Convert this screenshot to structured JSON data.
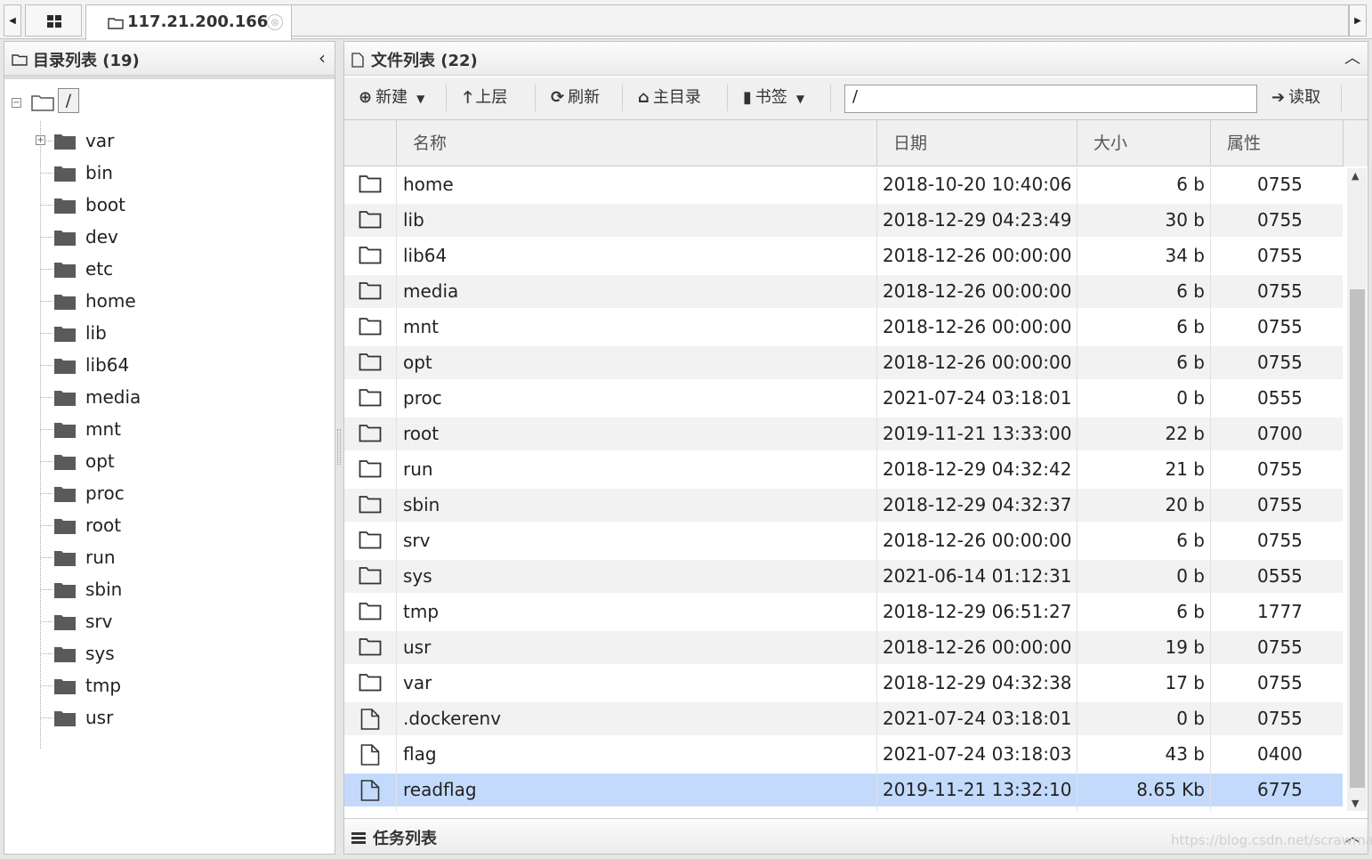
{
  "tabs": {
    "active_label": "117.21.200.166",
    "close_symbol": "⊗"
  },
  "left_panel": {
    "title": "目录列表 (19)",
    "root_label": "/",
    "tree": [
      {
        "label": "var",
        "expandable": true
      },
      {
        "label": "bin"
      },
      {
        "label": "boot"
      },
      {
        "label": "dev"
      },
      {
        "label": "etc"
      },
      {
        "label": "home"
      },
      {
        "label": "lib"
      },
      {
        "label": "lib64"
      },
      {
        "label": "media"
      },
      {
        "label": "mnt"
      },
      {
        "label": "opt"
      },
      {
        "label": "proc"
      },
      {
        "label": "root"
      },
      {
        "label": "run"
      },
      {
        "label": "sbin"
      },
      {
        "label": "srv"
      },
      {
        "label": "sys"
      },
      {
        "label": "tmp"
      },
      {
        "label": "usr"
      }
    ]
  },
  "right_panel": {
    "title": "文件列表 (22)",
    "toolbar": {
      "new_label": "新建",
      "up_label": "上层",
      "refresh_label": "刷新",
      "home_label": "主目录",
      "bookmark_label": "书签",
      "path_value": "/",
      "read_label": "读取"
    },
    "columns": {
      "name": "名称",
      "date": "日期",
      "size": "大小",
      "perm": "属性"
    },
    "files": [
      {
        "type": "folder",
        "name": "home",
        "date": "2018-10-20 10:40:06",
        "size": "6 b",
        "perm": "0755"
      },
      {
        "type": "folder",
        "name": "lib",
        "date": "2018-12-29 04:23:49",
        "size": "30 b",
        "perm": "0755"
      },
      {
        "type": "folder",
        "name": "lib64",
        "date": "2018-12-26 00:00:00",
        "size": "34 b",
        "perm": "0755"
      },
      {
        "type": "folder",
        "name": "media",
        "date": "2018-12-26 00:00:00",
        "size": "6 b",
        "perm": "0755"
      },
      {
        "type": "folder",
        "name": "mnt",
        "date": "2018-12-26 00:00:00",
        "size": "6 b",
        "perm": "0755"
      },
      {
        "type": "folder",
        "name": "opt",
        "date": "2018-12-26 00:00:00",
        "size": "6 b",
        "perm": "0755"
      },
      {
        "type": "folder",
        "name": "proc",
        "date": "2021-07-24 03:18:01",
        "size": "0 b",
        "perm": "0555"
      },
      {
        "type": "folder",
        "name": "root",
        "date": "2019-11-21 13:33:00",
        "size": "22 b",
        "perm": "0700"
      },
      {
        "type": "folder",
        "name": "run",
        "date": "2018-12-29 04:32:42",
        "size": "21 b",
        "perm": "0755"
      },
      {
        "type": "folder",
        "name": "sbin",
        "date": "2018-12-29 04:32:37",
        "size": "20 b",
        "perm": "0755"
      },
      {
        "type": "folder",
        "name": "srv",
        "date": "2018-12-26 00:00:00",
        "size": "6 b",
        "perm": "0755"
      },
      {
        "type": "folder",
        "name": "sys",
        "date": "2021-06-14 01:12:31",
        "size": "0 b",
        "perm": "0555"
      },
      {
        "type": "folder",
        "name": "tmp",
        "date": "2018-12-29 06:51:27",
        "size": "6 b",
        "perm": "1777"
      },
      {
        "type": "folder",
        "name": "usr",
        "date": "2018-12-26 00:00:00",
        "size": "19 b",
        "perm": "0755"
      },
      {
        "type": "folder",
        "name": "var",
        "date": "2018-12-29 04:32:38",
        "size": "17 b",
        "perm": "0755"
      },
      {
        "type": "file",
        "name": ".dockerenv",
        "date": "2021-07-24 03:18:01",
        "size": "0 b",
        "perm": "0755"
      },
      {
        "type": "file",
        "name": "flag",
        "date": "2021-07-24 03:18:03",
        "size": "43 b",
        "perm": "0400"
      },
      {
        "type": "file",
        "name": "readflag",
        "date": "2019-11-21 13:32:10",
        "size": "8.65 Kb",
        "perm": "6775",
        "selected": true
      }
    ]
  },
  "taskbar": {
    "title": "任务列表"
  },
  "watermark": "https://blog.csdn.net/scrawman",
  "colors": {
    "selected_row": "#c4dafc",
    "alt_row": "#f2f2f2",
    "folder_icon": "#5a5a5a"
  },
  "icons": {
    "grid": "grid-icon",
    "folder": "folder-icon",
    "file": "file-icon",
    "plus_circle": "plus-circle-icon",
    "arrow_up": "arrow-up-icon",
    "refresh": "refresh-icon",
    "home": "home-icon",
    "bookmark": "bookmark-icon",
    "arrow_right": "arrow-right-icon",
    "tasks": "tasks-icon"
  }
}
